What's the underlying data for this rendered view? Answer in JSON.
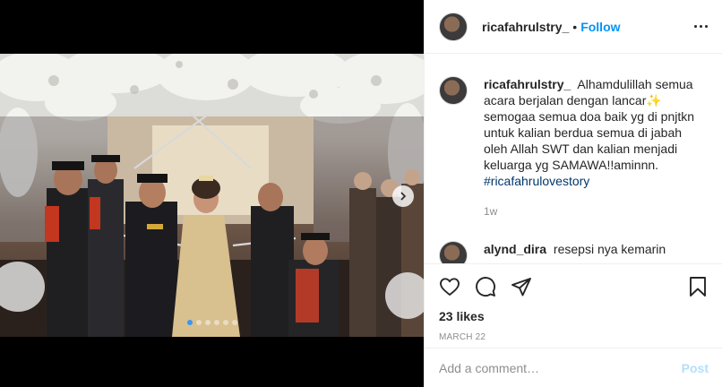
{
  "post": {
    "author": {
      "username": "ricafahrulstry_",
      "separator": "•",
      "follow_label": "Follow"
    },
    "caption": {
      "username": "ricafahrulstry_",
      "text": "Alhamdulillah semua acara berjalan dengan lancar",
      "emoji": "✨",
      "text2": "semogaa semua doa baik yg di pnjtkn untuk kalian berdua semua di jabah oleh Allah SWT dan kalian menjadi keluarga yg SAMAWA!!aminnn.",
      "hashtag": "#ricafahrulovestory",
      "time": "1w"
    },
    "next_comment": {
      "username": "alynd_dira",
      "text": "resepsi nya kemarin"
    },
    "likes": "23 likes",
    "date": "MARCH 22",
    "add_comment": {
      "placeholder": "Add a comment…",
      "post_label": "Post"
    },
    "carousel": {
      "slides": 6,
      "active": 0
    }
  },
  "colors": {
    "link_blue": "#0095f6",
    "hashtag": "#00376b",
    "post_disabled": "#b2dffc",
    "active_dot": "#3897f0"
  },
  "icons": [
    "heart-icon",
    "comment-icon",
    "share-icon",
    "bookmark-icon",
    "more-icon",
    "chevron-right-icon"
  ]
}
